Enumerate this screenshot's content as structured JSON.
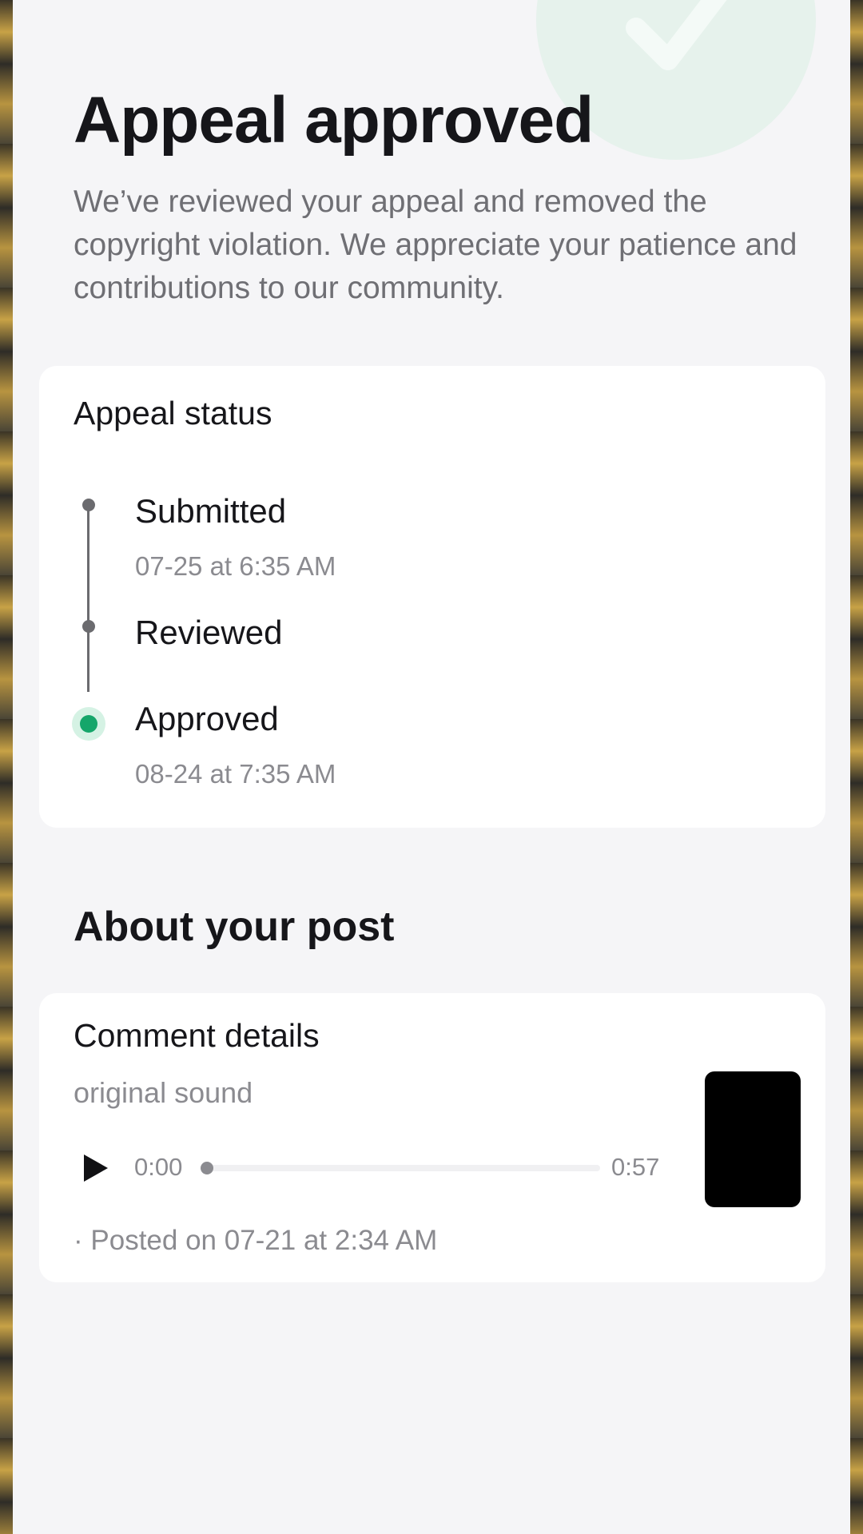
{
  "header": {
    "title": "Appeal approved",
    "description": "We’ve reviewed your appeal and removed the copyright violation. We appreciate your patience and contributions to our community."
  },
  "status_card": {
    "title": "Appeal status",
    "steps": [
      {
        "label": "Submitted",
        "time": "07-25 at 6:35 AM"
      },
      {
        "label": "Reviewed",
        "time": ""
      },
      {
        "label": "Approved",
        "time": "08-24 at 7:35 AM"
      }
    ]
  },
  "about_section": {
    "heading": "About your post"
  },
  "post_card": {
    "title": "Comment details",
    "sound": "original sound",
    "player": {
      "current_time": "0:00",
      "duration": "0:57",
      "progress": 0
    },
    "posted": "· Posted on 07-21 at 2:34 AM"
  },
  "colors": {
    "accent_green": "#15a66a",
    "accent_green_light": "#d5f2e4",
    "text_primary": "#16161a",
    "text_secondary": "#8b8b90",
    "sheet_background": "#f5f5f7"
  },
  "icons": {
    "status_check": "checkmark-icon",
    "play": "play-icon"
  }
}
